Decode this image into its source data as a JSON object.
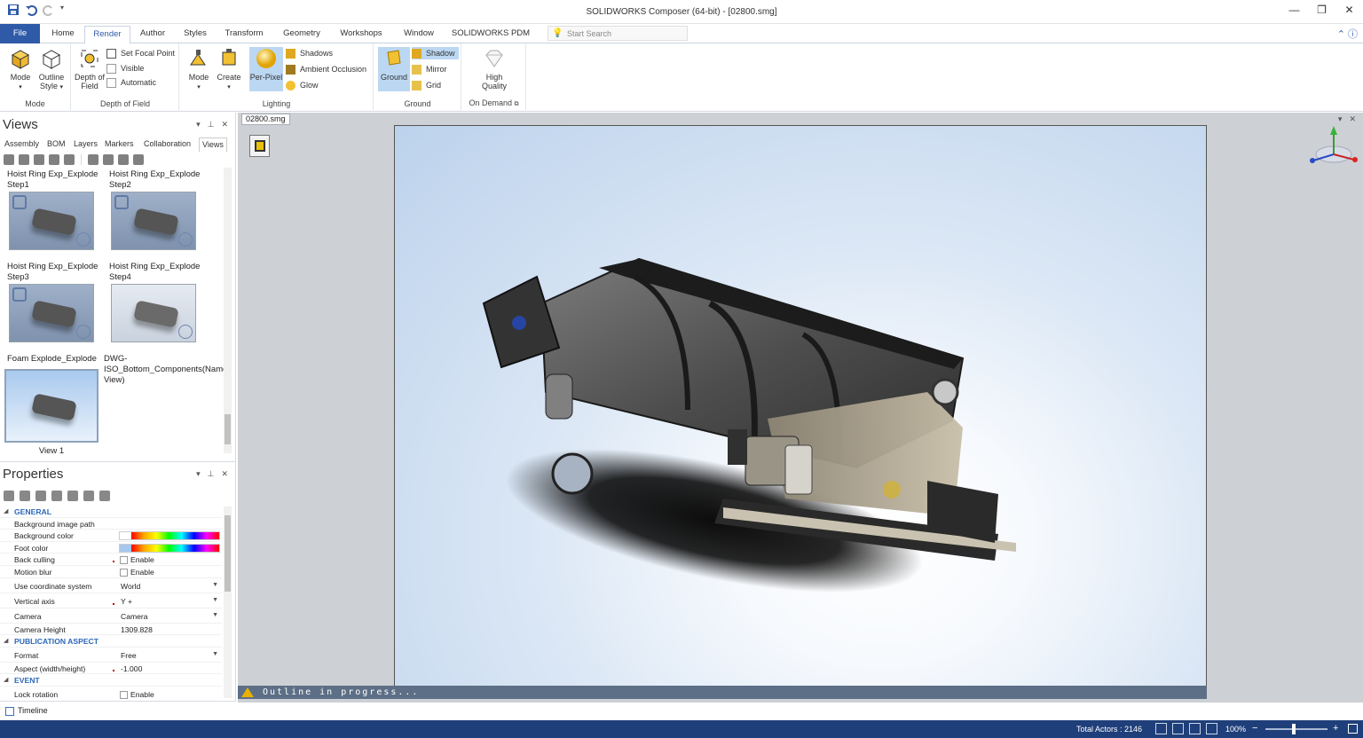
{
  "window": {
    "title": "SOLIDWORKS Composer (64-bit) - [02800.smg]",
    "controls": [
      "—",
      "❐",
      "✕"
    ]
  },
  "ribbon_tabs": [
    "File",
    "Home",
    "Render",
    "Author",
    "Styles",
    "Transform",
    "Geometry",
    "Workshops",
    "Window",
    "SOLIDWORKS PDM"
  ],
  "active_tab": "Render",
  "search": {
    "placeholder": "Start Search"
  },
  "ribbon": {
    "mode_group": {
      "label": "Mode",
      "mode_btn": "Mode",
      "outline_btn": "Outline Style"
    },
    "dof_group": {
      "label": "Depth of Field",
      "dof_btn": "Depth of Field",
      "focal": "Set Focal Point",
      "visible": "Visible",
      "automatic": "Automatic"
    },
    "lighting_group": {
      "label": "Lighting",
      "mode_btn": "Mode",
      "create_btn": "Create",
      "perpixel_btn": "Per-Pixel",
      "shadows": "Shadows",
      "ao": "Ambient Occlusion",
      "glow": "Glow"
    },
    "ground_group": {
      "label": "Ground",
      "ground_btn": "Ground",
      "shadow": "Shadow",
      "mirror": "Mirror",
      "grid": "Grid"
    },
    "ondemand_group": {
      "label": "On Demand",
      "hq_btn": "High Quality"
    }
  },
  "views_panel": {
    "title": "Views",
    "tabs": [
      "Assembly",
      "BOM",
      "Layers",
      "Markers",
      "Collaboration",
      "Views"
    ],
    "active_tab": "Views",
    "items": [
      {
        "caption": "Hoist Ring Exp_Explode Step1"
      },
      {
        "caption": "Hoist Ring Exp_Explode Step2"
      },
      {
        "caption": "Hoist Ring Exp_Explode Step3"
      },
      {
        "caption": "Hoist Ring Exp_Explode Step4"
      },
      {
        "caption": "Foam Explode_Explode"
      },
      {
        "caption": "DWG-ISO_Bottom_Components(Named View)"
      },
      {
        "caption": "View 1"
      }
    ]
  },
  "properties_panel": {
    "title": "Properties",
    "rows": [
      {
        "type": "section",
        "key": "GENERAL"
      },
      {
        "type": "text",
        "key": "Background image path",
        "value": ""
      },
      {
        "type": "color",
        "key": "Background color",
        "value": ""
      },
      {
        "type": "color",
        "key": "Foot color",
        "value": ""
      },
      {
        "type": "check",
        "key": "Back culling",
        "value": "Enable"
      },
      {
        "type": "check",
        "key": "Motion blur",
        "value": "Enable"
      },
      {
        "type": "dropdown",
        "key": "Use coordinate system",
        "value": "World"
      },
      {
        "type": "dropdown",
        "key": "Vertical axis",
        "value": "Y +"
      },
      {
        "type": "dropdown",
        "key": "Camera",
        "value": "Camera"
      },
      {
        "type": "text",
        "key": "Camera Height",
        "value": "1309.828"
      },
      {
        "type": "section",
        "key": "PUBLICATION ASPECT"
      },
      {
        "type": "dropdown",
        "key": "Format",
        "value": "Free"
      },
      {
        "type": "text",
        "key": "Aspect (width/height)",
        "value": "-1.000"
      },
      {
        "type": "section",
        "key": "EVENT"
      },
      {
        "type": "check",
        "key": "Lock rotation",
        "value": "Enable"
      }
    ]
  },
  "timeline": {
    "label": "Timeline"
  },
  "document": {
    "tab": "02800.smg",
    "status_message": "Outline in progress..."
  },
  "statusbar": {
    "actors": "Total Actors : 2146",
    "zoom": "100%"
  },
  "colors": {
    "accent": "#2e5aa8",
    "statusbar": "#1f3f7a",
    "section_text": "#2b68b8",
    "selected_btn": "#bcd7f2",
    "foot_color": "#a6c8ee"
  }
}
